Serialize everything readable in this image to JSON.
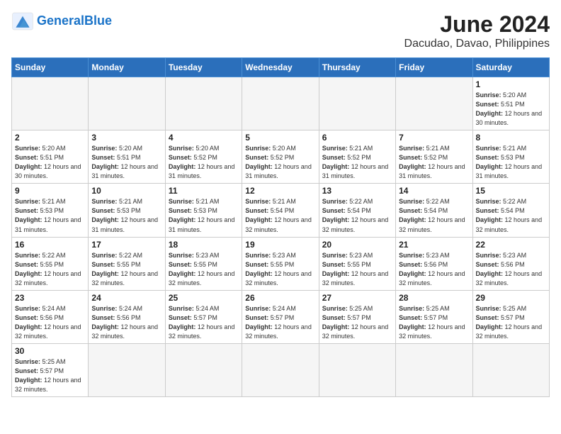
{
  "header": {
    "logo_general": "General",
    "logo_blue": "Blue",
    "month": "June 2024",
    "location": "Dacudao, Davao, Philippines"
  },
  "weekdays": [
    "Sunday",
    "Monday",
    "Tuesday",
    "Wednesday",
    "Thursday",
    "Friday",
    "Saturday"
  ],
  "weeks": [
    [
      {
        "day": "",
        "empty": true
      },
      {
        "day": "",
        "empty": true
      },
      {
        "day": "",
        "empty": true
      },
      {
        "day": "",
        "empty": true
      },
      {
        "day": "",
        "empty": true
      },
      {
        "day": "",
        "empty": true
      },
      {
        "day": "1",
        "sunrise": "5:20 AM",
        "sunset": "5:51 PM",
        "daylight": "12 hours and 30 minutes."
      }
    ],
    [
      {
        "day": "2",
        "sunrise": "5:20 AM",
        "sunset": "5:51 PM",
        "daylight": "12 hours and 30 minutes."
      },
      {
        "day": "3",
        "sunrise": "5:20 AM",
        "sunset": "5:51 PM",
        "daylight": "12 hours and 31 minutes."
      },
      {
        "day": "4",
        "sunrise": "5:20 AM",
        "sunset": "5:52 PM",
        "daylight": "12 hours and 31 minutes."
      },
      {
        "day": "5",
        "sunrise": "5:20 AM",
        "sunset": "5:52 PM",
        "daylight": "12 hours and 31 minutes."
      },
      {
        "day": "6",
        "sunrise": "5:21 AM",
        "sunset": "5:52 PM",
        "daylight": "12 hours and 31 minutes."
      },
      {
        "day": "7",
        "sunrise": "5:21 AM",
        "sunset": "5:52 PM",
        "daylight": "12 hours and 31 minutes."
      },
      {
        "day": "8",
        "sunrise": "5:21 AM",
        "sunset": "5:53 PM",
        "daylight": "12 hours and 31 minutes."
      }
    ],
    [
      {
        "day": "9",
        "sunrise": "5:21 AM",
        "sunset": "5:53 PM",
        "daylight": "12 hours and 31 minutes."
      },
      {
        "day": "10",
        "sunrise": "5:21 AM",
        "sunset": "5:53 PM",
        "daylight": "12 hours and 31 minutes."
      },
      {
        "day": "11",
        "sunrise": "5:21 AM",
        "sunset": "5:53 PM",
        "daylight": "12 hours and 31 minutes."
      },
      {
        "day": "12",
        "sunrise": "5:21 AM",
        "sunset": "5:54 PM",
        "daylight": "12 hours and 32 minutes."
      },
      {
        "day": "13",
        "sunrise": "5:22 AM",
        "sunset": "5:54 PM",
        "daylight": "12 hours and 32 minutes."
      },
      {
        "day": "14",
        "sunrise": "5:22 AM",
        "sunset": "5:54 PM",
        "daylight": "12 hours and 32 minutes."
      },
      {
        "day": "15",
        "sunrise": "5:22 AM",
        "sunset": "5:54 PM",
        "daylight": "12 hours and 32 minutes."
      }
    ],
    [
      {
        "day": "16",
        "sunrise": "5:22 AM",
        "sunset": "5:55 PM",
        "daylight": "12 hours and 32 minutes."
      },
      {
        "day": "17",
        "sunrise": "5:22 AM",
        "sunset": "5:55 PM",
        "daylight": "12 hours and 32 minutes."
      },
      {
        "day": "18",
        "sunrise": "5:23 AM",
        "sunset": "5:55 PM",
        "daylight": "12 hours and 32 minutes."
      },
      {
        "day": "19",
        "sunrise": "5:23 AM",
        "sunset": "5:55 PM",
        "daylight": "12 hours and 32 minutes."
      },
      {
        "day": "20",
        "sunrise": "5:23 AM",
        "sunset": "5:55 PM",
        "daylight": "12 hours and 32 minutes."
      },
      {
        "day": "21",
        "sunrise": "5:23 AM",
        "sunset": "5:56 PM",
        "daylight": "12 hours and 32 minutes."
      },
      {
        "day": "22",
        "sunrise": "5:23 AM",
        "sunset": "5:56 PM",
        "daylight": "12 hours and 32 minutes."
      }
    ],
    [
      {
        "day": "23",
        "sunrise": "5:24 AM",
        "sunset": "5:56 PM",
        "daylight": "12 hours and 32 minutes."
      },
      {
        "day": "24",
        "sunrise": "5:24 AM",
        "sunset": "5:56 PM",
        "daylight": "12 hours and 32 minutes."
      },
      {
        "day": "25",
        "sunrise": "5:24 AM",
        "sunset": "5:57 PM",
        "daylight": "12 hours and 32 minutes."
      },
      {
        "day": "26",
        "sunrise": "5:24 AM",
        "sunset": "5:57 PM",
        "daylight": "12 hours and 32 minutes."
      },
      {
        "day": "27",
        "sunrise": "5:25 AM",
        "sunset": "5:57 PM",
        "daylight": "12 hours and 32 minutes."
      },
      {
        "day": "28",
        "sunrise": "5:25 AM",
        "sunset": "5:57 PM",
        "daylight": "12 hours and 32 minutes."
      },
      {
        "day": "29",
        "sunrise": "5:25 AM",
        "sunset": "5:57 PM",
        "daylight": "12 hours and 32 minutes."
      }
    ],
    [
      {
        "day": "30",
        "sunrise": "5:25 AM",
        "sunset": "5:57 PM",
        "daylight": "12 hours and 32 minutes."
      },
      {
        "day": "",
        "empty": true
      },
      {
        "day": "",
        "empty": true
      },
      {
        "day": "",
        "empty": true
      },
      {
        "day": "",
        "empty": true
      },
      {
        "day": "",
        "empty": true
      },
      {
        "day": "",
        "empty": true
      }
    ]
  ],
  "labels": {
    "sunrise": "Sunrise:",
    "sunset": "Sunset:",
    "daylight": "Daylight:"
  }
}
